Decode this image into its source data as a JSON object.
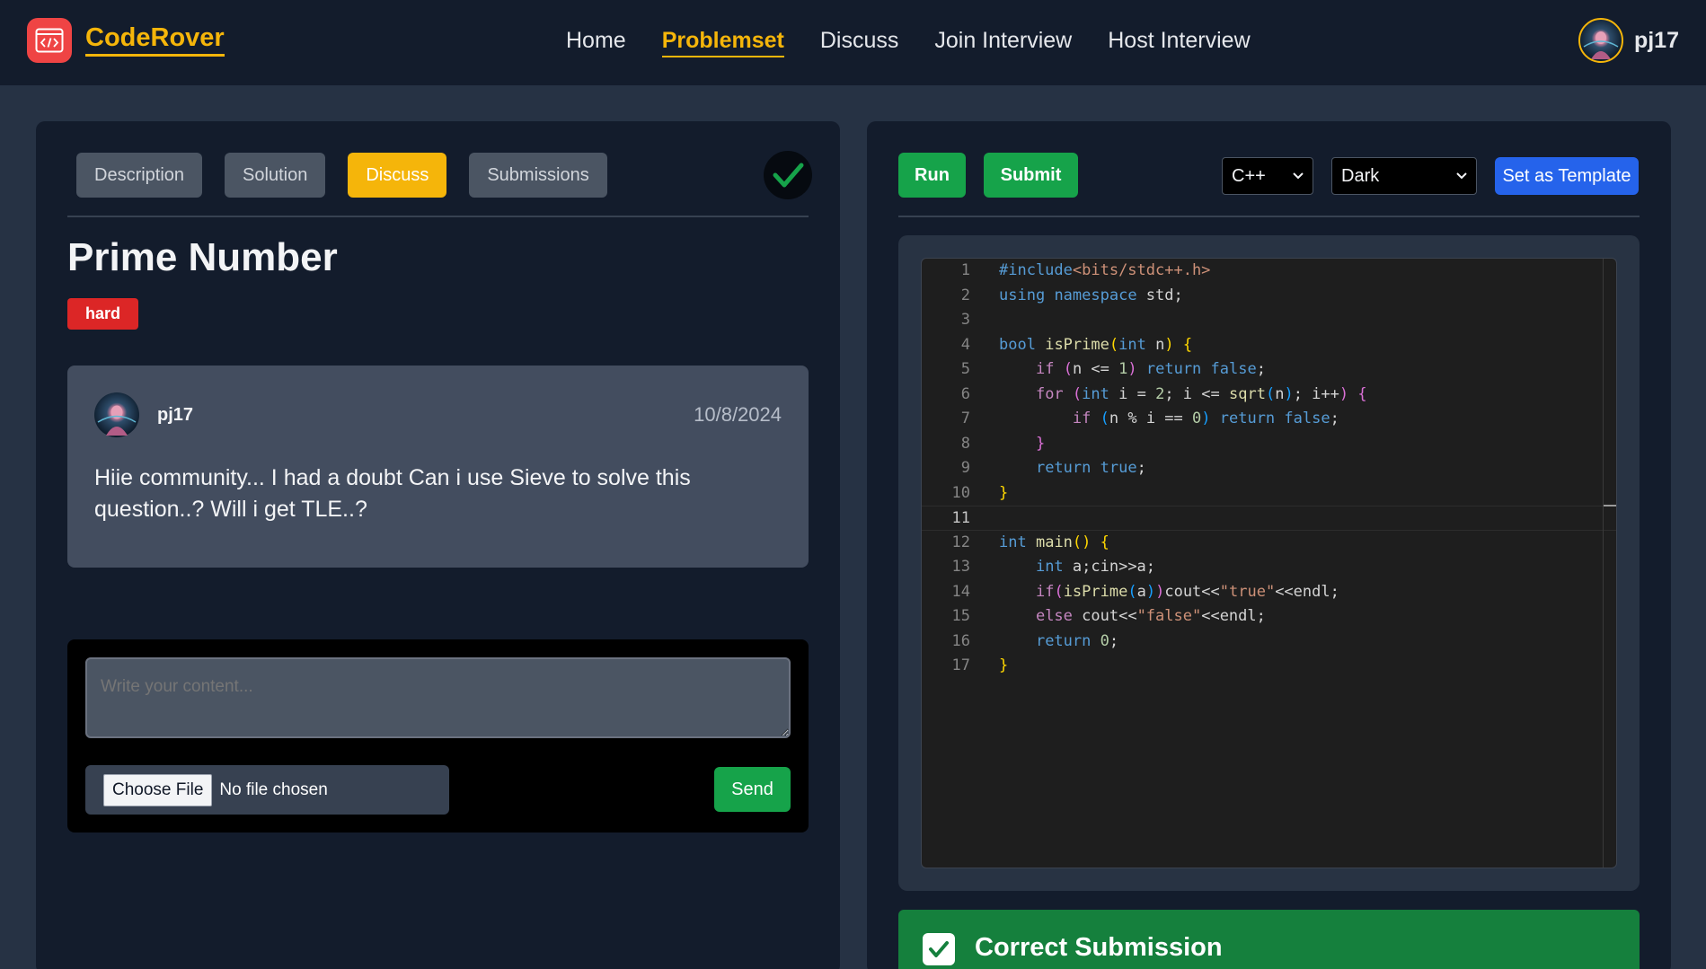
{
  "brand": {
    "name": "CodeRover"
  },
  "nav": {
    "links": [
      "Home",
      "Problemset",
      "Discuss",
      "Join Interview",
      "Host Interview"
    ],
    "active": "Problemset",
    "username": "pj17"
  },
  "problem": {
    "tabs": [
      "Description",
      "Solution",
      "Discuss",
      "Submissions"
    ],
    "active_tab": "Discuss",
    "title": "Prime Number",
    "difficulty": "hard",
    "solved": true
  },
  "discussion": {
    "post": {
      "author": "pj17",
      "date": "10/8/2024",
      "content": "Hiie community... I had a doubt Can i use Sieve to solve this question..? Will i get TLE..?"
    },
    "composer": {
      "placeholder": "Write your content...",
      "file_button": "Choose File",
      "file_status": "No file chosen",
      "send_label": "Send"
    }
  },
  "editor_toolbar": {
    "run_label": "Run",
    "submit_label": "Submit",
    "language": "C++",
    "theme": "Dark",
    "template_label": "Set as Template"
  },
  "code": {
    "current_line": 11,
    "lines": [
      "#include<bits/stdc++.h>",
      "using namespace std;",
      "",
      "bool isPrime(int n) {",
      "    if (n <= 1) return false;",
      "    for (int i = 2; i <= sqrt(n); i++) {",
      "        if (n % i == 0) return false;",
      "    }",
      "    return true;",
      "}",
      "",
      "int main() {",
      "    int a;cin>>a;",
      "    if(isPrime(a))cout<<\"true\"<<endl;",
      "    else cout<<\"false\"<<endl;",
      "    return 0;",
      "}"
    ]
  },
  "result": {
    "status": "Correct Submission"
  },
  "colors": {
    "accent": "#f5b50a",
    "success": "#16a34a",
    "danger": "#dc2626",
    "primary": "#2563eb"
  }
}
